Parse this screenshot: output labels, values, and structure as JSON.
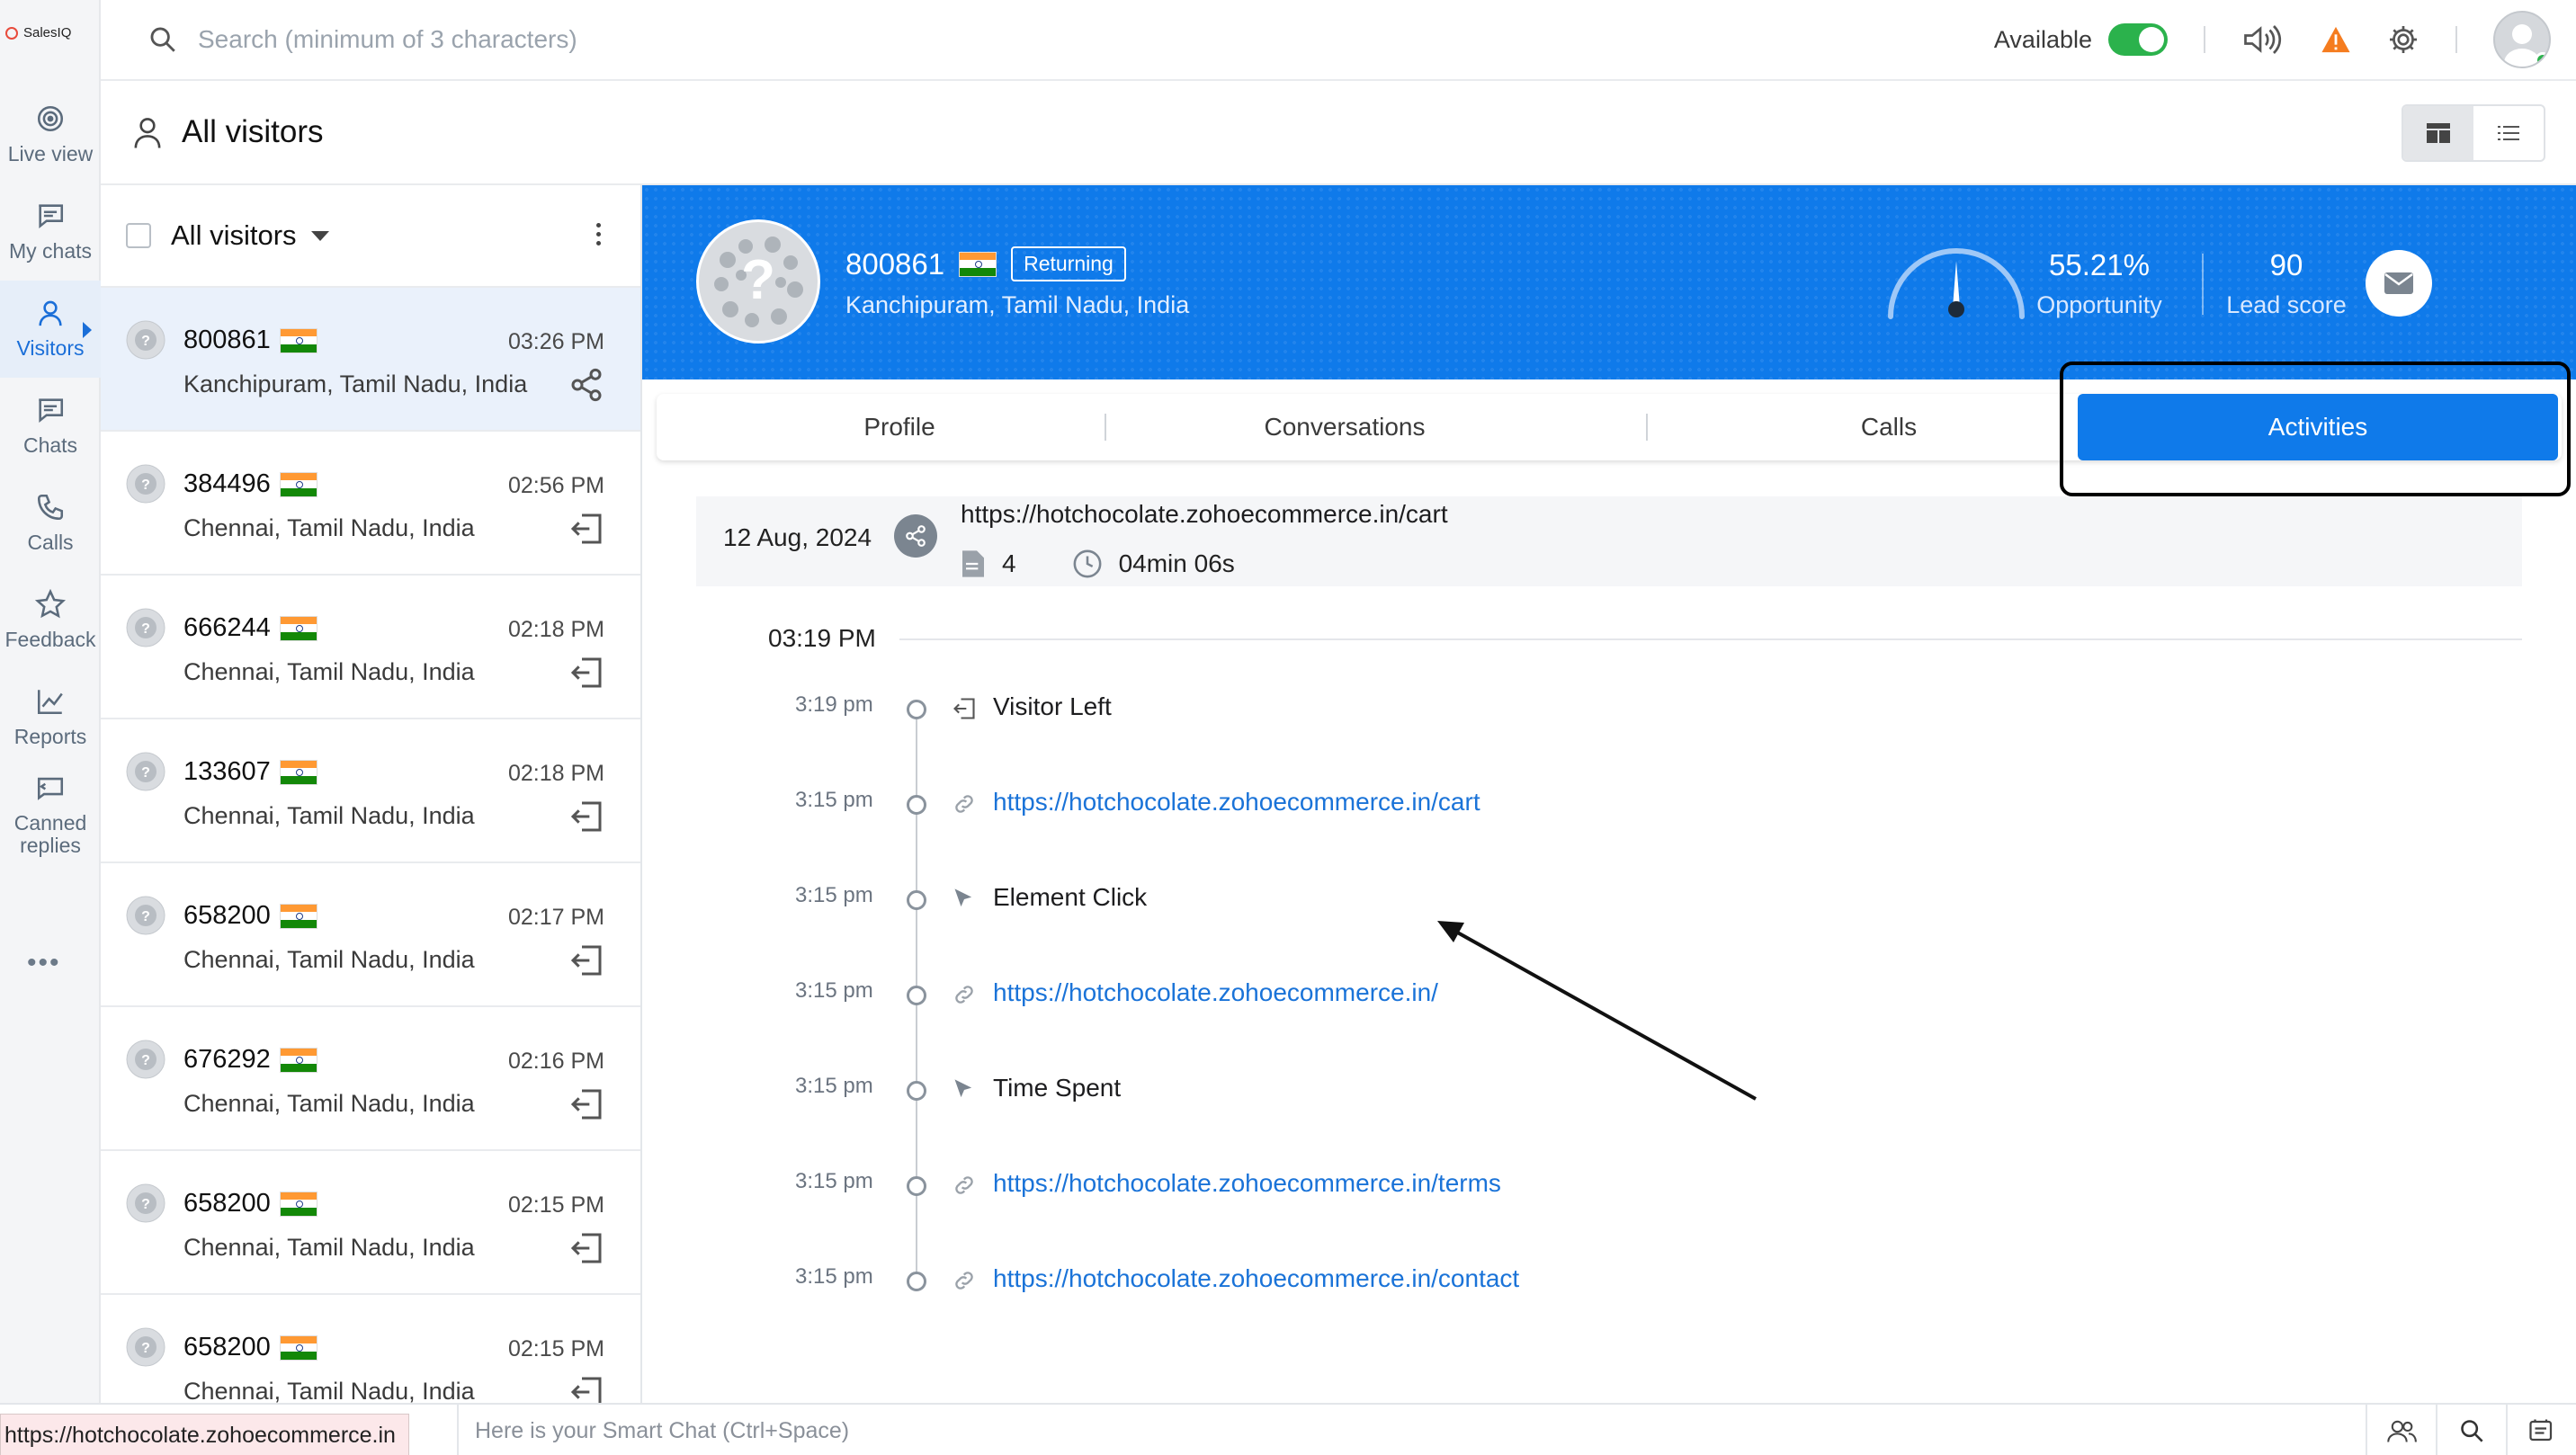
{
  "app": {
    "logo_text": "SalesIQ"
  },
  "rail": {
    "items": [
      {
        "label": "Live view",
        "icon": "live-view-icon"
      },
      {
        "label": "My chats",
        "icon": "my-chats-icon"
      },
      {
        "label": "Visitors",
        "icon": "visitors-icon",
        "active": true
      },
      {
        "label": "Chats",
        "icon": "chats-icon"
      },
      {
        "label": "Calls",
        "icon": "phone-icon"
      },
      {
        "label": "Feedback",
        "icon": "star-icon"
      },
      {
        "label": "Reports",
        "icon": "chart-icon"
      },
      {
        "label": "Canned replies",
        "icon": "canned-replies-icon"
      }
    ],
    "more": "•••"
  },
  "topbar": {
    "search_placeholder": "Search (minimum of 3 characters)",
    "status_label": "Available",
    "status_on": true,
    "accent_green": "#2bb24c",
    "warning_color": "#f57c1f"
  },
  "page": {
    "title": "All visitors"
  },
  "list": {
    "filter_label": "All visitors",
    "visitors": [
      {
        "id": "800861",
        "time": "03:26 PM",
        "location": "Kanchipuram, Tamil Nadu, India",
        "action_icon": "share-icon",
        "selected": true
      },
      {
        "id": "384496",
        "time": "02:56 PM",
        "location": "Chennai, Tamil Nadu, India",
        "action_icon": "visitor-left-icon"
      },
      {
        "id": "666244",
        "time": "02:18 PM",
        "location": "Chennai, Tamil Nadu, India",
        "action_icon": "visitor-left-icon"
      },
      {
        "id": "133607",
        "time": "02:18 PM",
        "location": "Chennai, Tamil Nadu, India",
        "action_icon": "visitor-left-icon"
      },
      {
        "id": "658200",
        "time": "02:17 PM",
        "location": "Chennai, Tamil Nadu, India",
        "action_icon": "visitor-left-icon"
      },
      {
        "id": "676292",
        "time": "02:16 PM",
        "location": "Chennai, Tamil Nadu, India",
        "action_icon": "visitor-left-icon"
      },
      {
        "id": "658200",
        "time": "02:15 PM",
        "location": "Chennai, Tamil Nadu, India",
        "action_icon": "visitor-left-icon"
      },
      {
        "id": "658200",
        "time": "02:15 PM",
        "location": "Chennai, Tamil Nadu, India",
        "action_icon": "visitor-left-icon"
      }
    ]
  },
  "detail": {
    "visitor_id": "800861",
    "badge": "Returning",
    "location": "Kanchipuram, Tamil Nadu, India",
    "opportunity_value": "55.21%",
    "opportunity_label": "Opportunity",
    "lead_score_value": "90",
    "lead_score_label": "Lead score",
    "banner_color": "#0f7aea",
    "tabs": [
      {
        "label": "Profile"
      },
      {
        "label": "Conversations"
      },
      {
        "label": "Calls"
      },
      {
        "label": "Activities",
        "active": true
      }
    ],
    "session": {
      "date": "12 Aug, 2024",
      "url": "https://hotchocolate.zohoecommerce.in/cart",
      "pages": "4",
      "duration": "04min 06s"
    },
    "time_group": "03:19 PM",
    "events": [
      {
        "time": "3:19 pm",
        "text": "Visitor Left",
        "icon": "visitor-left-icon",
        "link": false
      },
      {
        "time": "3:15 pm",
        "text": "https://hotchocolate.zohoecommerce.in/cart",
        "icon": "link-icon",
        "link": true
      },
      {
        "time": "3:15 pm",
        "text": "Element Click",
        "icon": "cursor-icon",
        "link": false
      },
      {
        "time": "3:15 pm",
        "text": "https://hotchocolate.zohoecommerce.in/",
        "icon": "link-icon",
        "link": true
      },
      {
        "time": "3:15 pm",
        "text": "Time Spent",
        "icon": "cursor-icon",
        "link": false
      },
      {
        "time": "3:15 pm",
        "text": "https://hotchocolate.zohoecommerce.in/terms",
        "icon": "link-icon",
        "link": true
      },
      {
        "time": "3:15 pm",
        "text": "https://hotchocolate.zohoecommerce.in/contact",
        "icon": "link-icon",
        "link": true
      }
    ]
  },
  "bottombar": {
    "status_url": "https://hotchocolate.zohoecommerce.in",
    "smart_chat_placeholder": "Here is your Smart Chat (Ctrl+Space)"
  }
}
